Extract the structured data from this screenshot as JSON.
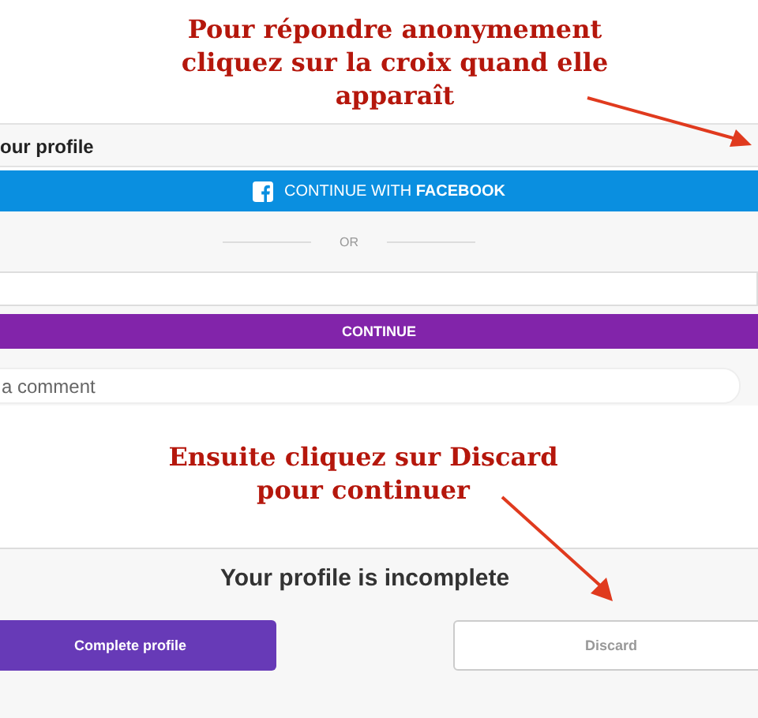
{
  "top_note": {
    "text": "Pour répondre anonymement\ncliquez sur la croix quand elle\napparaît"
  },
  "login_panel": {
    "title": "our profile",
    "facebook_button": "CONTINUE WITH **FACEBOOK**",
    "divider": "OR",
    "continue_button": "CONTINUE"
  },
  "comment_field": {
    "placeholder": "a comment"
  },
  "bottom_note": {
    "text": "Ensuite cliquez sur Discard\npour continuer"
  },
  "incomplete_panel": {
    "title": "Your profile is incomplete",
    "buttons": [
      {
        "label": "Complete profile",
        "kind": "primary"
      },
      {
        "label": "Discard",
        "kind": "secondary"
      }
    ]
  }
}
